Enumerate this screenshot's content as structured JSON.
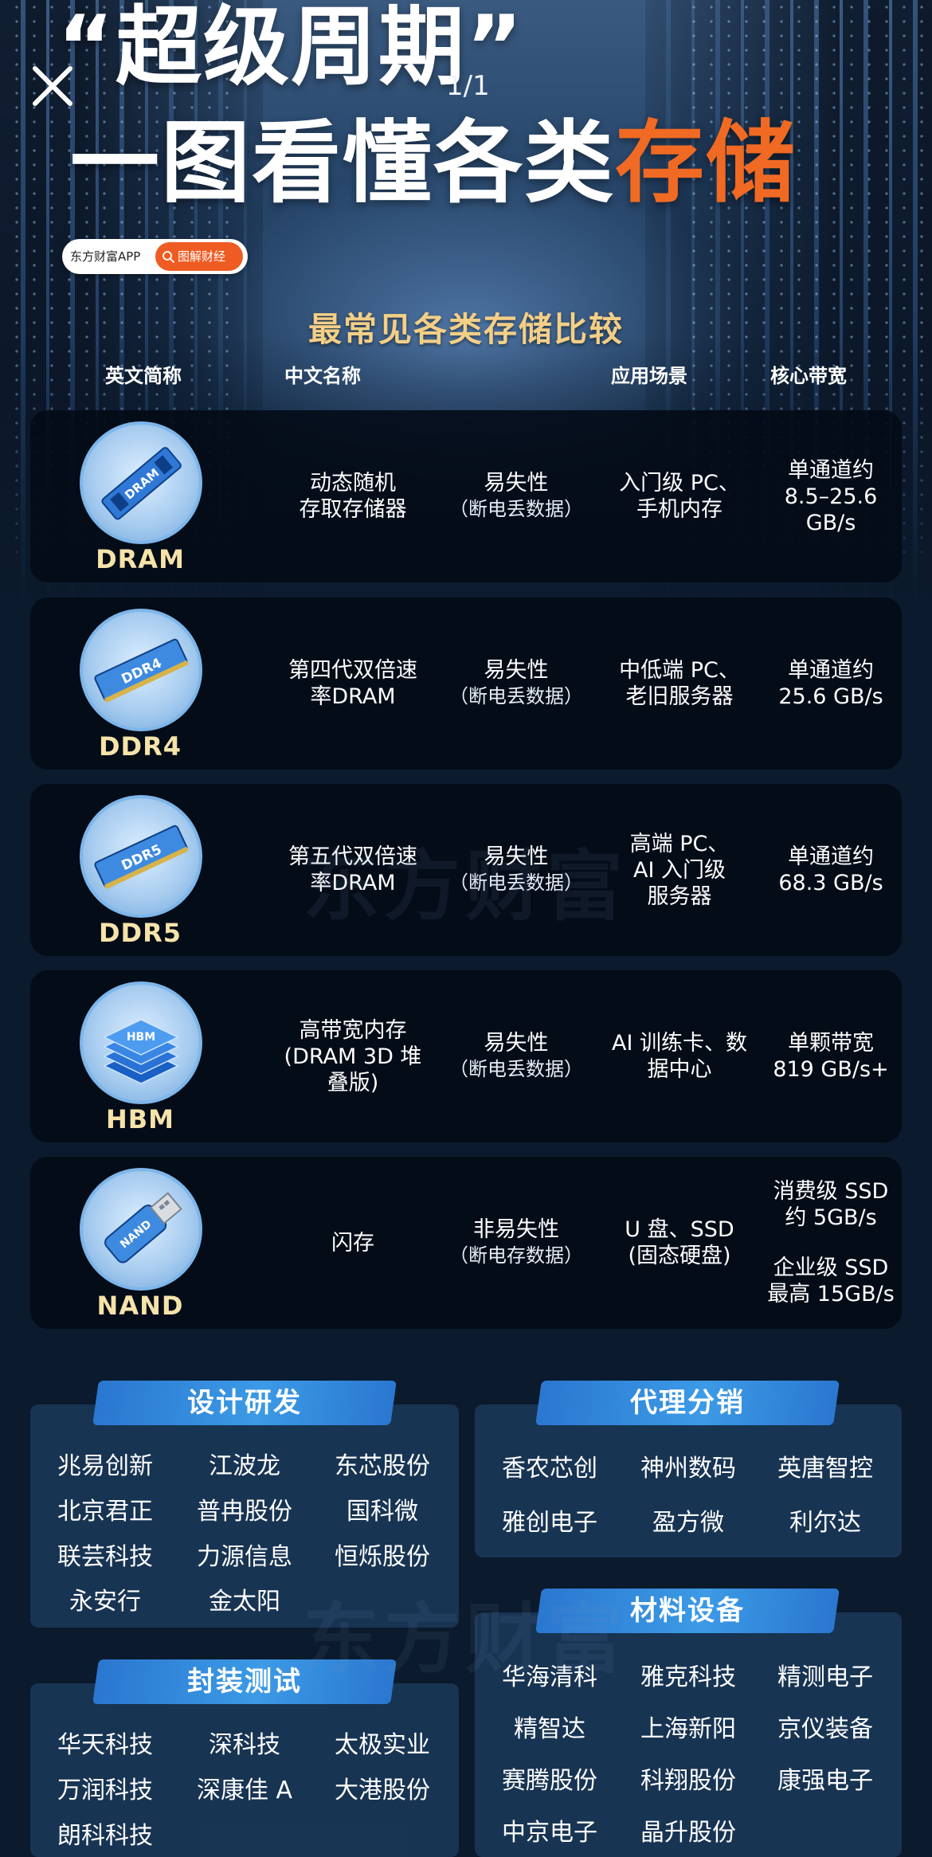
{
  "header": {
    "title_line1": "“超级周期”",
    "title_line2_white": "一图看懂各类",
    "title_line2_orange": "存储",
    "page_counter": "1/1",
    "badge_app": "东方财富APP",
    "badge_label": "图解财经"
  },
  "section_title": "最常见各类存储比较",
  "columns": {
    "abbr": "英文简称",
    "cn": "中文名称",
    "app": "应用场景",
    "bw": "核心带宽"
  },
  "rows": [
    {
      "abbr": "DRAM",
      "icon": "dram-chip-icon",
      "chip_label": "DRAM",
      "cn": [
        "动态随机",
        "存取存储器"
      ],
      "volatility": "易失性",
      "volatility_note": "（断电丢数据）",
      "app": [
        "入门级 PC、",
        "手机内存"
      ],
      "bw": [
        "单通道约",
        "8.5–25.6",
        "GB/s"
      ]
    },
    {
      "abbr": "DDR4",
      "icon": "ddr4-chip-icon",
      "chip_label": "DDR4",
      "cn": [
        "第四代双倍速",
        "率DRAM"
      ],
      "volatility": "易失性",
      "volatility_note": "（断电丢数据）",
      "app": [
        "中低端 PC、",
        "老旧服务器"
      ],
      "bw": [
        "单通道约",
        "25.6 GB/s"
      ]
    },
    {
      "abbr": "DDR5",
      "icon": "ddr5-chip-icon",
      "chip_label": "DDR5",
      "cn": [
        "第五代双倍速",
        "率DRAM"
      ],
      "volatility": "易失性",
      "volatility_note": "（断电丢数据）",
      "app": [
        "高端 PC、",
        "AI 入门级",
        "服务器"
      ],
      "bw": [
        "单通道约",
        "68.3 GB/s"
      ]
    },
    {
      "abbr": "HBM",
      "icon": "hbm-stack-icon",
      "chip_label": "HBM",
      "cn": [
        "高带宽内存",
        "(DRAM 3D 堆",
        "叠版)"
      ],
      "volatility": "易失性",
      "volatility_note": "（断电丢数据）",
      "app": [
        "AI 训练卡、数",
        "据中心"
      ],
      "bw": [
        "单颗带宽",
        "819 GB/s+"
      ]
    },
    {
      "abbr": "NAND",
      "icon": "usb-drive-icon",
      "chip_label": "NAND",
      "cn": [
        "闪存"
      ],
      "volatility": "非易失性",
      "volatility_note": "（断电存数据）",
      "app": [
        "U 盘、SSD",
        "(固态硬盘)"
      ],
      "bw": [
        "消费级 SSD",
        "约 5GB/s"
      ],
      "bw2": [
        "企业级 SSD",
        "最高 15GB/s"
      ]
    }
  ],
  "watermark": "东方财富",
  "categories": {
    "design": {
      "title": "设计研发",
      "companies": [
        "兆易创新",
        "江波龙",
        "东芯股份",
        "北京君正",
        "普冉股份",
        "国科微",
        "联芸科技",
        "力源信息",
        "恒烁股份",
        "永安行",
        "金太阳"
      ]
    },
    "distribution": {
      "title": "代理分销",
      "companies": [
        "香农芯创",
        "神州数码",
        "英唐智控",
        "雅创电子",
        "盈方微",
        "利尔达"
      ]
    },
    "packaging": {
      "title": "封装测试",
      "companies": [
        "华天科技",
        "深科技",
        "太极实业",
        "万润科技",
        "深康佳 A",
        "大港股份",
        "朗科科技"
      ]
    },
    "materials": {
      "title": "材料设备",
      "companies": [
        "华海清科",
        "雅克科技",
        "精测电子",
        "精智达",
        "上海新阳",
        "京仪装备",
        "赛腾股份",
        "科翔股份",
        "康强电子",
        "中京电子",
        "晶升股份"
      ]
    }
  },
  "colors": {
    "accent_orange": "#f06a24",
    "title_gold": "#f3cf86",
    "abbr_gold": "#f6e3aa",
    "tag_blue": "#3c9ae6"
  }
}
